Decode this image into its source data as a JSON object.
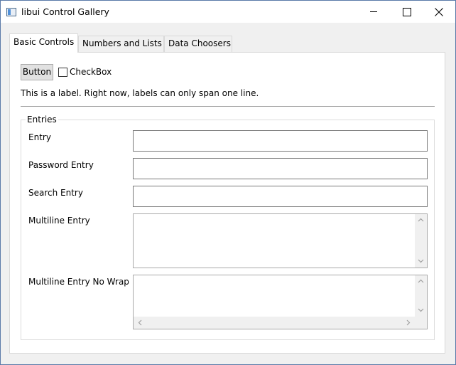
{
  "window": {
    "title": "libui Control Gallery"
  },
  "tabs": [
    {
      "label": "Basic Controls",
      "active": true
    },
    {
      "label": "Numbers and Lists",
      "active": false
    },
    {
      "label": "Data Choosers",
      "active": false
    }
  ],
  "basic": {
    "button_label": "Button",
    "checkbox_label": "CheckBox",
    "checkbox_checked": false,
    "info_label": "This is a label. Right now, labels can only span one line."
  },
  "entries": {
    "group_title": "Entries",
    "entry_label": "Entry",
    "entry_value": "",
    "password_label": "Password Entry",
    "password_value": "",
    "search_label": "Search Entry",
    "search_value": "",
    "multiline_label": "Multiline Entry",
    "multiline_value": "",
    "multiline_nowrap_label": "Multiline Entry No Wrap",
    "multiline_nowrap_value": ""
  },
  "icons": {
    "app": "app-window-icon",
    "minimize": "minimize-icon",
    "maximize": "maximize-icon",
    "close": "close-icon",
    "scroll_up": "chevron-up-icon",
    "scroll_down": "chevron-down-icon",
    "scroll_left": "chevron-left-icon",
    "scroll_right": "chevron-right-icon"
  },
  "colors": {
    "window_border": "#5a7aa8",
    "button_bg": "#e1e1e1",
    "panel_bg": "#ffffff",
    "chrome_bg": "#f0f0f0"
  }
}
